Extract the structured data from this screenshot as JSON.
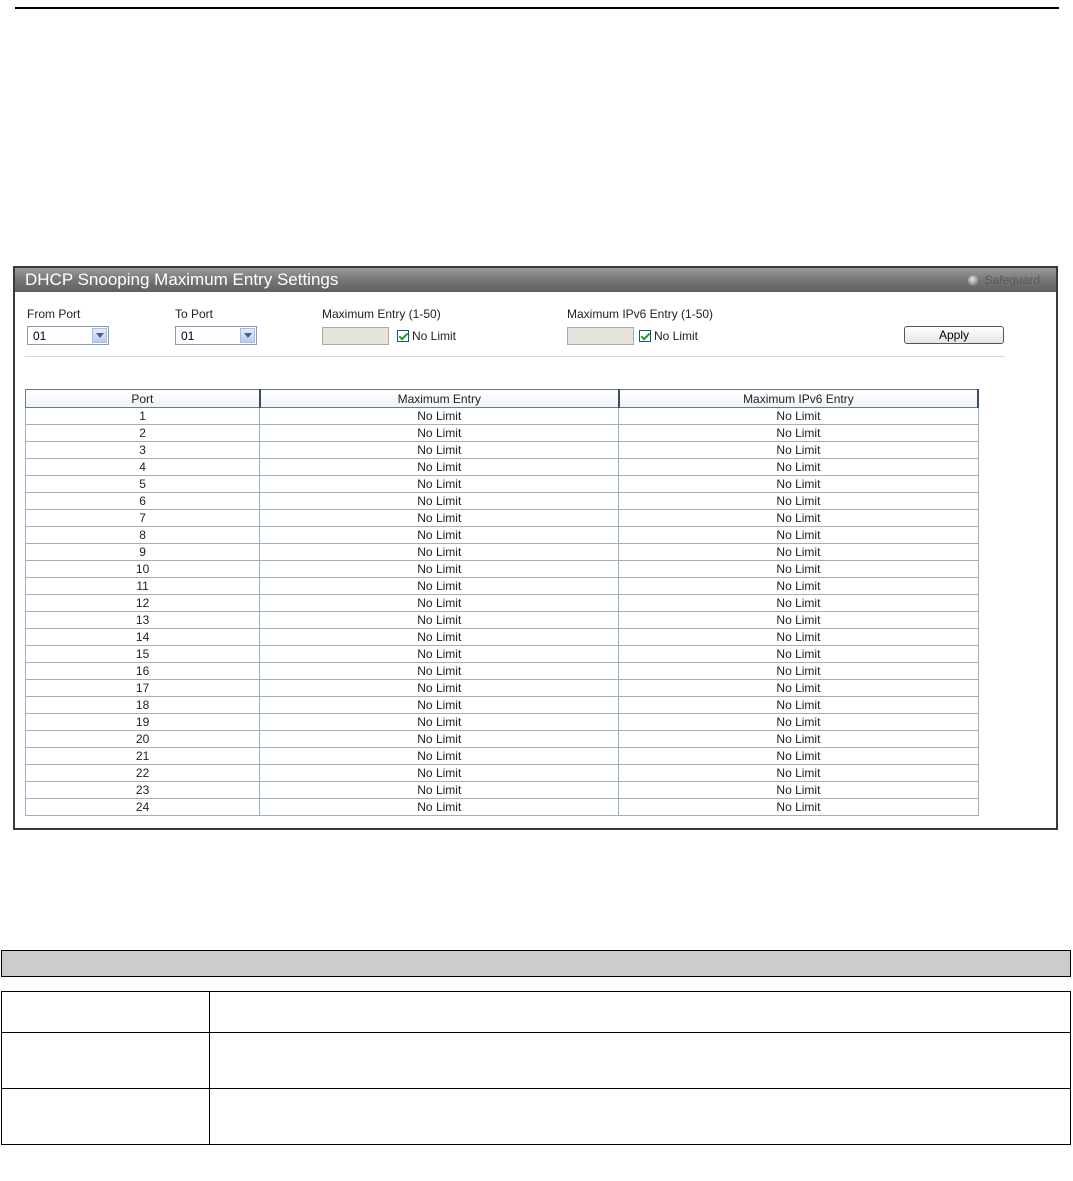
{
  "panel": {
    "title": "DHCP Snooping Maximum Entry Settings",
    "safeguard_label": "Safeguard"
  },
  "form": {
    "from_port_label": "From Port",
    "from_port_value": "01",
    "to_port_label": "To Port",
    "to_port_value": "01",
    "max_entry_label": "Maximum Entry (1-50)",
    "max_entry_value": "",
    "max_entry_no_limit_label": "No Limit",
    "max_entry_no_limit_checked": true,
    "max_ipv6_label": "Maximum IPv6 Entry (1-50)",
    "max_ipv6_value": "",
    "max_ipv6_no_limit_label": "No Limit",
    "max_ipv6_no_limit_checked": true,
    "apply_label": "Apply"
  },
  "table": {
    "headers": [
      "Port",
      "Maximum Entry",
      "Maximum IPv6 Entry"
    ],
    "rows": [
      [
        "1",
        "No Limit",
        "No Limit"
      ],
      [
        "2",
        "No Limit",
        "No Limit"
      ],
      [
        "3",
        "No Limit",
        "No Limit"
      ],
      [
        "4",
        "No Limit",
        "No Limit"
      ],
      [
        "5",
        "No Limit",
        "No Limit"
      ],
      [
        "6",
        "No Limit",
        "No Limit"
      ],
      [
        "7",
        "No Limit",
        "No Limit"
      ],
      [
        "8",
        "No Limit",
        "No Limit"
      ],
      [
        "9",
        "No Limit",
        "No Limit"
      ],
      [
        "10",
        "No Limit",
        "No Limit"
      ],
      [
        "11",
        "No Limit",
        "No Limit"
      ],
      [
        "12",
        "No Limit",
        "No Limit"
      ],
      [
        "13",
        "No Limit",
        "No Limit"
      ],
      [
        "14",
        "No Limit",
        "No Limit"
      ],
      [
        "15",
        "No Limit",
        "No Limit"
      ],
      [
        "16",
        "No Limit",
        "No Limit"
      ],
      [
        "17",
        "No Limit",
        "No Limit"
      ],
      [
        "18",
        "No Limit",
        "No Limit"
      ],
      [
        "19",
        "No Limit",
        "No Limit"
      ],
      [
        "20",
        "No Limit",
        "No Limit"
      ],
      [
        "21",
        "No Limit",
        "No Limit"
      ],
      [
        "22",
        "No Limit",
        "No Limit"
      ],
      [
        "23",
        "No Limit",
        "No Limit"
      ],
      [
        "24",
        "No Limit",
        "No Limit"
      ]
    ]
  },
  "icons": {
    "safeguard": "safeguard-status-icon",
    "dropdown": "chevron-down-icon",
    "checkbox": "checkmark-icon"
  }
}
